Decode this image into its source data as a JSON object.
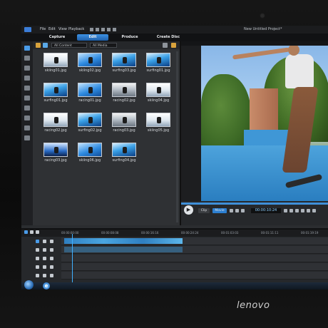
{
  "window": {
    "title": "New Untitled Project*"
  },
  "menu": {
    "items": [
      "File",
      "Edit",
      "View",
      "Playback"
    ]
  },
  "tabs": [
    {
      "label": "Capture"
    },
    {
      "label": "Edit"
    },
    {
      "label": "Produce"
    },
    {
      "label": "Create Disc"
    }
  ],
  "library": {
    "filter_content": "All Content",
    "filter_media": "All Media",
    "items": [
      {
        "label": "skiing01.jpg"
      },
      {
        "label": "skiing02.jpg"
      },
      {
        "label": "surfing03.jpg"
      },
      {
        "label": "surfing01.jpg"
      },
      {
        "label": "surfing01.jpg"
      },
      {
        "label": "racing01.jpg"
      },
      {
        "label": "racing02.jpg"
      },
      {
        "label": "skiing04.jpg"
      },
      {
        "label": "racing02.jpg"
      },
      {
        "label": "surfing02.jpg"
      },
      {
        "label": "racing03.jpg"
      },
      {
        "label": "skiing05.jpg"
      },
      {
        "label": "racing03.jpg"
      },
      {
        "label": "skiing06.jpg"
      },
      {
        "label": "surfing04.jpg"
      }
    ]
  },
  "preview": {
    "clip_label": "Clip",
    "movie_label": "Movie",
    "timecode": "00:00:10:24"
  },
  "timeline": {
    "ruler": [
      "00:00:00:00",
      "00:00:08:08",
      "00:00:16:16",
      "00:00:24:24",
      "00:01:03:03",
      "00:01:11:11",
      "00:01:19:19"
    ]
  },
  "brand": {
    "name": "lenovo"
  }
}
